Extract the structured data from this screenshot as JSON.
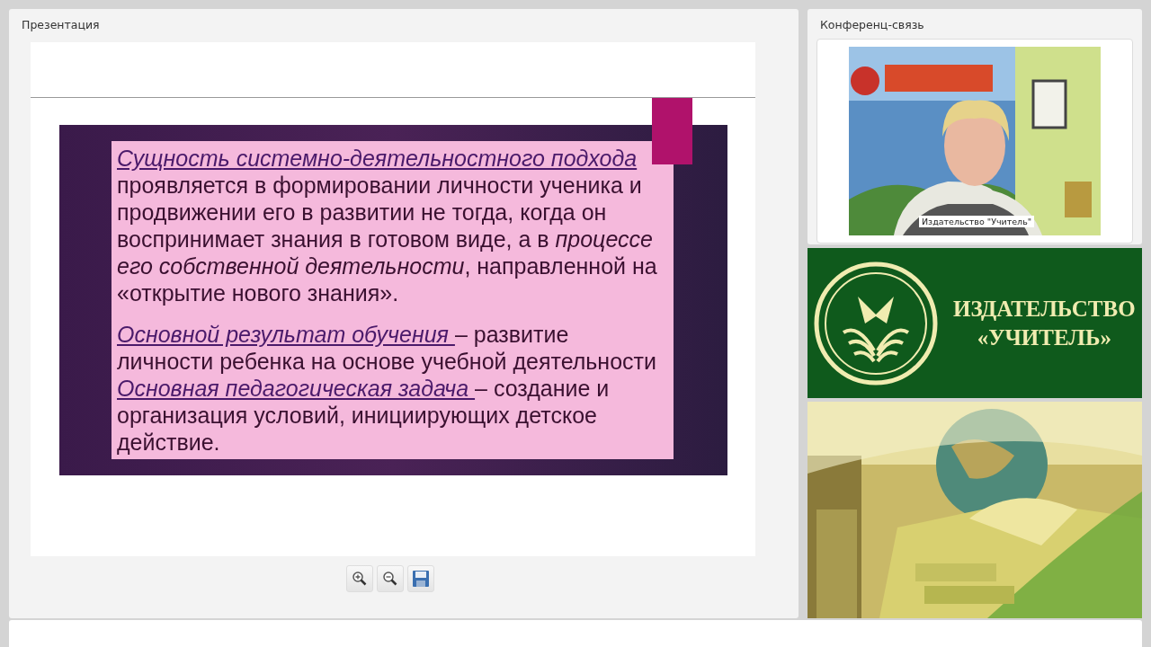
{
  "presentation": {
    "title": "Презентация",
    "slide": {
      "paragraphs": [
        {
          "term": "Сущность системно-деятельностного подхода",
          "text": "проявляется в формировании личности ученика и продвижении его в развитии не тогда, когда он воспринимает знания в готовом виде, а в *процессе его собственной деятельности*, направленной на «открытие нового знания».",
          "gap": true
        },
        {
          "term": "Основной результат обучения ",
          "text": "– развитие личности ребенка на основе учебной деятельности",
          "gap": false
        },
        {
          "term": "Основная педагогическая задача ",
          "text": "– создание и организация условий, инициирующих детское действие.",
          "gap": false
        }
      ]
    },
    "toolbar": [
      {
        "kind": "zoom-in"
      },
      {
        "kind": "zoom-out"
      },
      {
        "kind": "save"
      }
    ]
  },
  "conference": {
    "title": "Конференц-связь",
    "video": {
      "kind": "picture",
      "caption": "Издательство \"Учитель\""
    }
  },
  "banner": {
    "line_1": "ИЗДАТЕЛЬСТВО",
    "line_2": "«УЧИТЕЛЬ»"
  }
}
